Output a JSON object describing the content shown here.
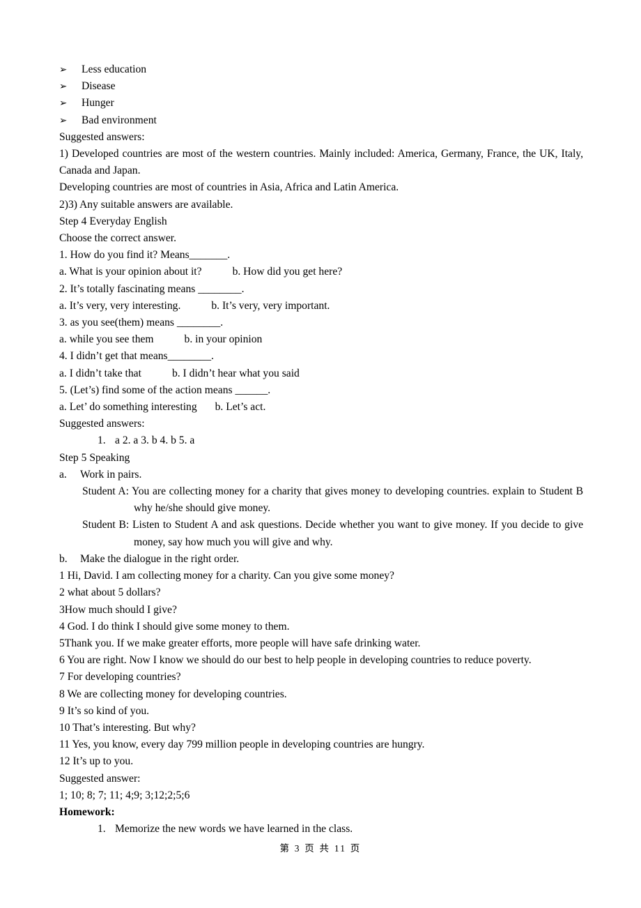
{
  "icons": {
    "bullet": "arrow-bullet-icon",
    "bullet_glyph": "➢"
  },
  "bullets": [
    {
      "label": "Less education"
    },
    {
      "label": "Disease"
    },
    {
      "label": "Hunger"
    },
    {
      "label": "Bad environment"
    }
  ],
  "suggested_answers_heading_1": "Suggested answers:",
  "answers_block_1": [
    "1) Developed countries are most of the western countries. Mainly included: America, Germany, France, the UK, Italy, Canada and Japan.",
    "Developing countries are most of countries in Asia, Africa and Latin America.",
    "2)3) Any suitable answers are available."
  ],
  "step4": {
    "heading": "Step 4 Everyday English",
    "instruction": "Choose the correct answer.",
    "questions": [
      {
        "stem": "1. How do you find it? Means_______.",
        "option_a": "a. What is your opinion about it?",
        "option_b": "b. How did you get here?"
      },
      {
        "stem": "2. It’s totally fascinating means ________.",
        "option_a": "a. It’s very, very interesting.",
        "option_b": "b. It’s very, very important."
      },
      {
        "stem": "3. as you see(them) means ________.",
        "option_a": "a. while you see them",
        "option_b": "b. in your opinion"
      },
      {
        "stem": "4. I didn’t get that means________.",
        "option_a": "a. I didn’t take that",
        "option_b": "b. I didn’t hear what you said"
      },
      {
        "stem": "5. (Let’s) find some of the action means ______.",
        "option_a": "a. Let’ do something interesting",
        "option_b": "b. Let’s act."
      }
    ],
    "answers_heading": "Suggested answers:",
    "answer_key_marker": "1.",
    "answer_key": "a 2. a 3. b 4. b 5. a"
  },
  "step5": {
    "heading": "Step 5 Speaking",
    "item_a_marker": "a.",
    "item_a_text": "Work in pairs.",
    "student_a": "Student A: You are collecting money for a charity that gives money to developing countries. explain to Student B why he/she should give money.",
    "student_b": "Student B: Listen to Student A and ask questions. Decide whether you want to give money. If you decide to give money, say how much you will give and why.",
    "item_b_marker": "b.",
    "item_b_text": "Make the dialogue in the right order.",
    "dialogue": [
      "1 Hi, David. I am collecting money for a charity. Can you give some money?",
      "2 what about 5 dollars?",
      "3How much should I give?",
      "4 God. I do think I should give some money to them.",
      "5Thank you. If we make greater efforts, more people will have safe drinking water.",
      "6 You are right. Now I know we should do our best to help people in developing countries to reduce poverty.",
      "7 For developing countries?",
      "8 We are collecting money for developing countries.",
      "9 It’s so kind of you.",
      "10 That’s interesting. But why?",
      "11 Yes, you know, every day 799 million people in developing countries are hungry.",
      "12 It’s up to you."
    ],
    "answer_heading": "Suggested answer:",
    "answer_value": "1; 10; 8; 7; 11; 4;9; 3;12;2;5;6"
  },
  "homework": {
    "heading": "Homework:",
    "items": [
      {
        "marker": "1.",
        "text": "Memorize the new words we have learned in the class."
      }
    ]
  },
  "footer": {
    "text": "第 3 页 共 11 页",
    "page_number": "3",
    "total_pages": "11"
  }
}
